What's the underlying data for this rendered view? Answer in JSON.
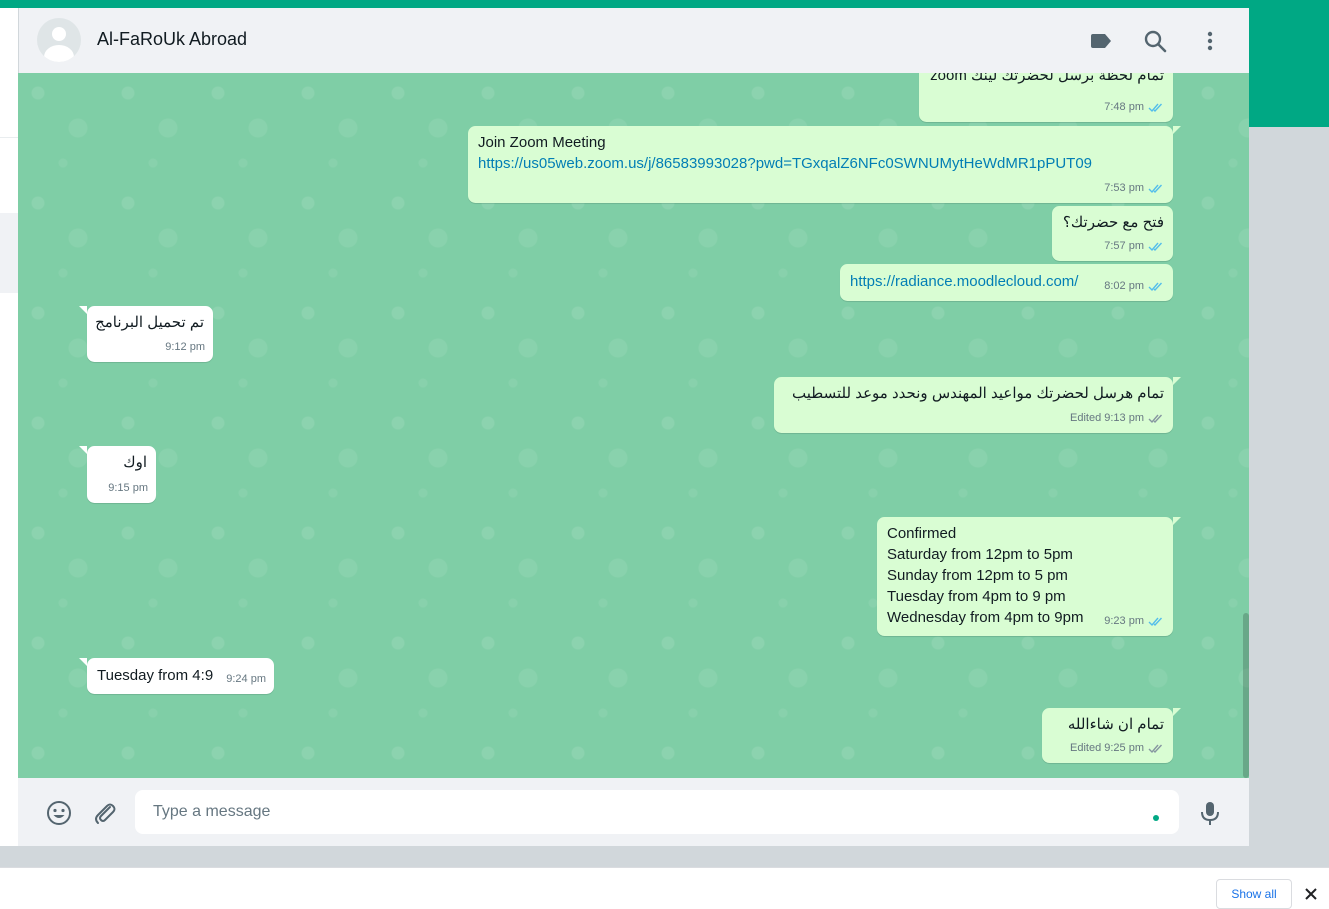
{
  "chat": {
    "contact_name": "Al-FaRoUk Abroad",
    "header_icons": [
      "label-icon",
      "search-icon",
      "menu-dots-icon"
    ]
  },
  "messages": [
    {
      "dir": "out",
      "lines": [
        "تمام لحظة برسل لحضرتك لينك zoom"
      ],
      "time": "7:48 pm",
      "status": "read"
    },
    {
      "dir": "out",
      "lines": [
        "Join Zoom Meeting"
      ],
      "link": "https://us05web.zoom.us/j/86583993028?pwd=TGxqalZ6NFc0SWNUMytHeWdMR1pPUT09",
      "time": "7:53 pm",
      "status": "read"
    },
    {
      "dir": "out",
      "lines": [
        "فتح مع حضرتك؟"
      ],
      "time": "7:57 pm",
      "status": "read"
    },
    {
      "dir": "out",
      "link": "https://radiance.moodlecloud.com/",
      "time": "8:02 pm",
      "status": "read"
    },
    {
      "dir": "in",
      "lines": [
        "تم تحميل البرنامج"
      ],
      "time": "9:12 pm"
    },
    {
      "dir": "out",
      "lines": [
        "تمام هرسل لحضرتك مواعيد المهندس ونحدد موعد للتسطيب"
      ],
      "time": "Edited 9:13 pm",
      "status": "delivered"
    },
    {
      "dir": "in",
      "lines": [
        "اوك"
      ],
      "time": "9:15 pm"
    },
    {
      "dir": "out",
      "lines": [
        "Confirmed",
        "Saturday from 12pm to 5pm",
        "Sunday from 12pm to 5 pm",
        "Tuesday from 4pm to 9 pm",
        "Wednesday from 4pm to 9pm"
      ],
      "time": "9:23 pm",
      "status": "read"
    },
    {
      "dir": "in",
      "lines": [
        "Tuesday from 4:9"
      ],
      "time": "9:24 pm"
    },
    {
      "dir": "out",
      "lines": [
        "تمام ان شاءالله"
      ],
      "time": "Edited 9:25 pm",
      "status": "delivered"
    }
  ],
  "footer": {
    "placeholder": "Type a message",
    "icons": [
      "emoji-icon",
      "attach-icon",
      "microphone-icon"
    ]
  },
  "download_bar": {
    "show_all_label": "Show all"
  },
  "colors": {
    "outgoing_bubble": "#d9fdd3",
    "incoming_bubble": "#ffffff",
    "chat_wallpaper": "#7fcea6",
    "accent": "#00a884",
    "read_ticks": "#53bdeb",
    "delivered_ticks": "#8696a0"
  }
}
